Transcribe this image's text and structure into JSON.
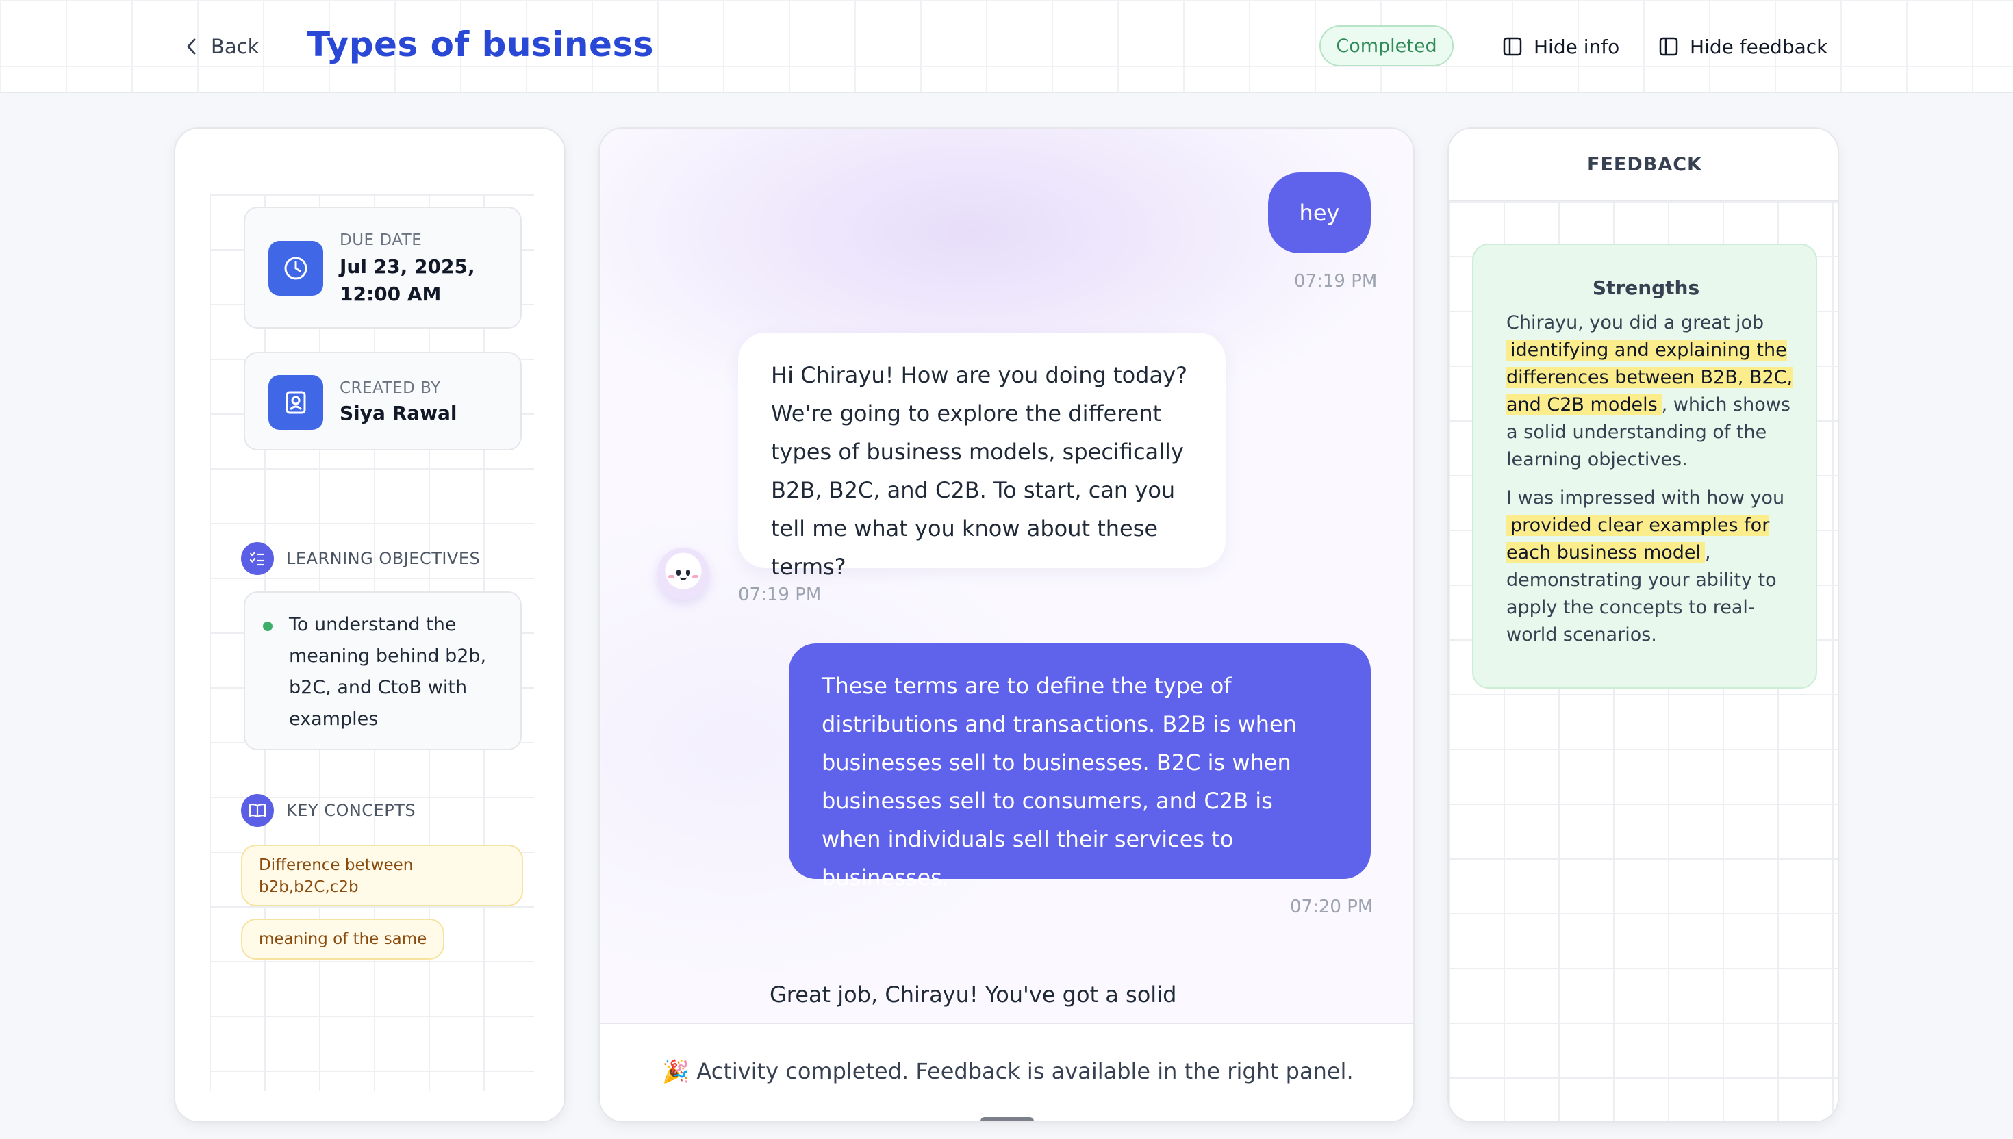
{
  "header": {
    "back_label": "Back",
    "title": "Types of business",
    "status": "Completed",
    "hide_info_label": "Hide info",
    "hide_feedback_label": "Hide feedback"
  },
  "info": {
    "due_label": "DUE DATE",
    "due_value": "Jul 23, 2025, 12:00 AM",
    "created_label": "CREATED BY",
    "created_value": "Siya Rawal",
    "objectives_label": "LEARNING OBJECTIVES",
    "objectives": [
      "To understand the meaning behind b2b, b2C, and CtoB with examples"
    ],
    "concepts_label": "KEY CONCEPTS",
    "concepts": [
      "Difference between b2b,b2C,c2b",
      "meaning of the same"
    ]
  },
  "chat": {
    "messages": [
      {
        "role": "user",
        "text": "hey",
        "time": "07:19 PM"
      },
      {
        "role": "assistant",
        "text": "Hi Chirayu! How are you doing today? We're going to explore the different types of business models, specifically B2B, B2C, and C2B. To start, can you tell me what you know about these terms?",
        "time": "07:19 PM"
      },
      {
        "role": "user",
        "text": "These terms are to define the type of distributions and transactions. B2B is when businesses sell to businesses. B2C is when businesses sell to consumers, and C2B is when individuals sell their services to businesses.",
        "time": "07:20 PM"
      },
      {
        "role": "assistant",
        "text": "Great job, Chirayu! You've got a solid"
      }
    ],
    "footer_icon": "🎉",
    "footer_text": "Activity completed. Feedback is available in the right panel."
  },
  "feedback": {
    "header": "FEEDBACK",
    "strengths_title": "Strengths",
    "p1_pre": "Chirayu, you did a great job",
    "p1_highlight": "identifying and explaining the differences between B2B, B2C, and C2B models",
    "p1_post": ", which shows a solid understanding of the learning objectives.",
    "p2_pre": "I was impressed with how you",
    "p2_highlight": "provided clear examples for each business model",
    "p2_post": ", demonstrating your ability to apply the concepts to real-world scenarios."
  },
  "colors": {
    "brand": "#2a48d6",
    "user_bubble": "#5f62ea",
    "completed_green": "#2f8a57",
    "highlight": "#fbec8c",
    "strengths_bg": "#e8f8ec"
  },
  "icons": {
    "back": "chevron-left-icon",
    "hide_info": "sidebar-panel-icon",
    "hide_feedback": "sidebar-panel-icon",
    "due_date": "clock-icon",
    "created_by": "user-badge-icon",
    "objectives": "checklist-icon",
    "concepts": "open-book-icon",
    "assistant": "bot-face-avatar"
  }
}
